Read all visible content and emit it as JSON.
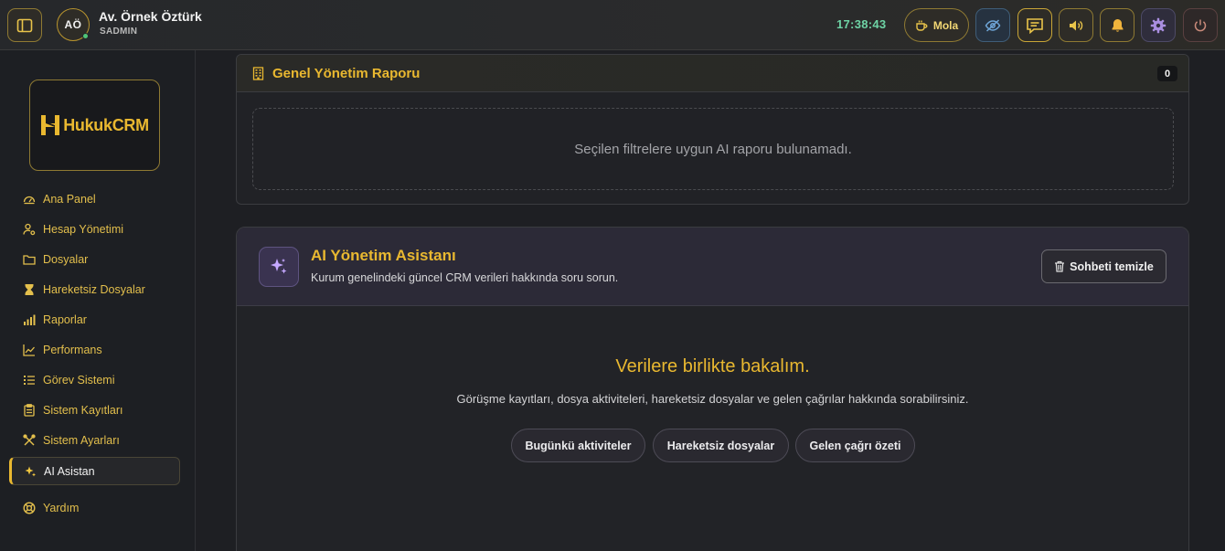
{
  "user": {
    "initials": "AÖ",
    "name": "Av. Örnek Öztürk",
    "role": "SADMIN"
  },
  "clock": "17:38:43",
  "topbar": {
    "break_label": "Mola"
  },
  "logo": {
    "text": "HukukCRM"
  },
  "nav": [
    {
      "label": "Ana Panel",
      "icon": "gauge-icon"
    },
    {
      "label": "Hesap Yönetimi",
      "icon": "user-cog-icon"
    },
    {
      "label": "Dosyalar",
      "icon": "folder-icon"
    },
    {
      "label": "Hareketsiz Dosyalar",
      "icon": "hourglass-icon"
    },
    {
      "label": "Raporlar",
      "icon": "bar-chart-icon"
    },
    {
      "label": "Performans",
      "icon": "trend-up-icon"
    },
    {
      "label": "Görev Sistemi",
      "icon": "list-icon"
    },
    {
      "label": "Sistem Kayıtları",
      "icon": "clipboard-icon"
    },
    {
      "label": "Sistem Ayarları",
      "icon": "tools-icon"
    },
    {
      "label": "AI Asistan",
      "icon": "sparkles-icon",
      "active": true
    },
    {
      "label": "Yardım",
      "icon": "lifebuoy-icon"
    }
  ],
  "report": {
    "title": "Genel Yönetim Raporu",
    "count": "0",
    "empty_text": "Seçilen filtrelere uygun AI raporu bulunamadı."
  },
  "assistant": {
    "title": "AI Yönetim Asistanı",
    "subtitle": "Kurum genelindeki güncel CRM verileri hakkında soru sorun.",
    "clear_label": "Sohbeti temizle",
    "welcome_title": "Verilere birlikte bakalım.",
    "welcome_sub": "Görüşme kayıtları, dosya aktiviteleri, hareketsiz dosyalar ve gelen çağrılar hakkında sorabilirsiniz.",
    "suggestions": [
      "Bugünkü aktiviteler",
      "Hareketsiz dosyalar",
      "Gelen çağrı özeti"
    ]
  },
  "colors": {
    "accent": "#e9b830",
    "clock": "#6ed3a5",
    "ai_purple": "#c5a8ff"
  }
}
